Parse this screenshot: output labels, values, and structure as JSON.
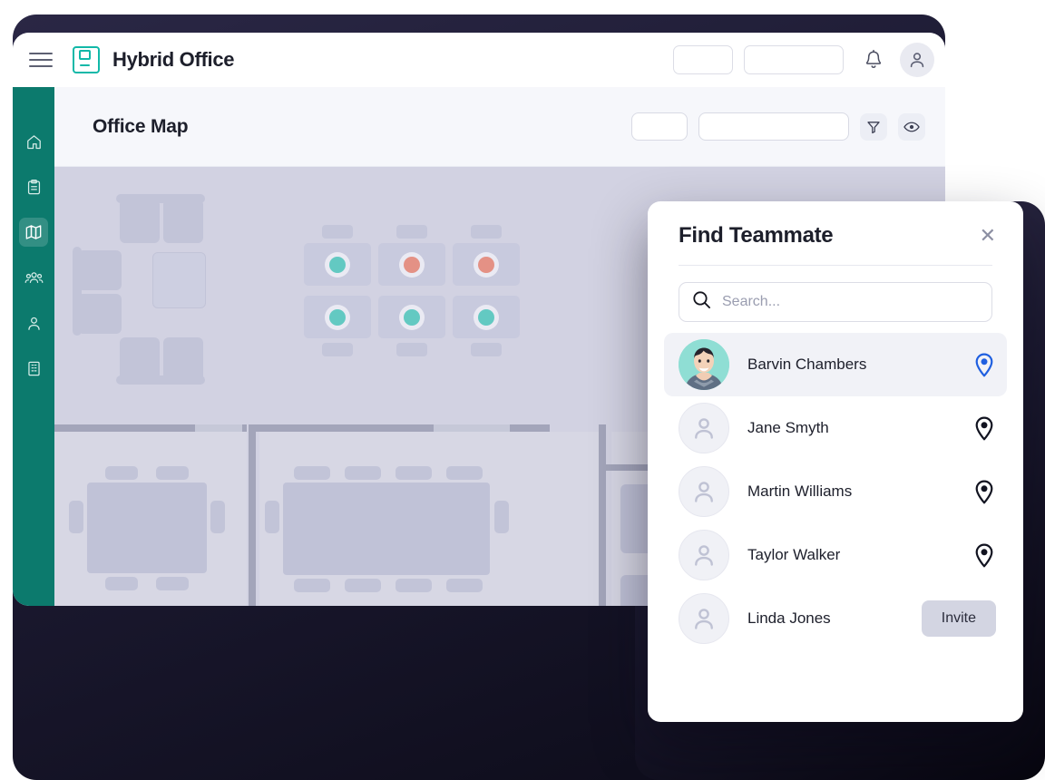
{
  "topbar": {
    "menu_icon": "hamburger-icon",
    "logo_icon": "hybrid-office-logo-icon",
    "brand": "Hybrid Office",
    "placeholder_small": "",
    "placeholder_large": "",
    "bell_icon": "bell-icon",
    "avatar_icon": "user-avatar-icon"
  },
  "sidebar": {
    "items": [
      {
        "name": "home",
        "icon": "home-icon",
        "active": false
      },
      {
        "name": "tasks",
        "icon": "clipboard-icon",
        "active": false
      },
      {
        "name": "map",
        "icon": "map-icon",
        "active": true
      },
      {
        "name": "teams",
        "icon": "users-icon",
        "active": false
      },
      {
        "name": "profile",
        "icon": "person-icon",
        "active": false
      },
      {
        "name": "buildings",
        "icon": "building-icon",
        "active": false
      }
    ]
  },
  "page": {
    "title": "Office Map",
    "field_small": "",
    "field_large": "",
    "filter_icon": "filter-icon",
    "eye_icon": "eye-icon"
  },
  "map": {
    "desks": [
      {
        "row": 1,
        "col": 1,
        "status_color": "#63c9c2"
      },
      {
        "row": 1,
        "col": 2,
        "status_color": "#e49185"
      },
      {
        "row": 1,
        "col": 3,
        "status_color": "#e49185"
      },
      {
        "row": 2,
        "col": 1,
        "status_color": "#63c9c2"
      },
      {
        "row": 2,
        "col": 2,
        "status_color": "#63c9c2"
      },
      {
        "row": 2,
        "col": 3,
        "status_color": "#63c9c2"
      }
    ]
  },
  "panel": {
    "title": "Find Teammate",
    "close_icon": "close-icon",
    "search_icon": "search-icon",
    "search_value": "",
    "search_placeholder": "Search...",
    "people": [
      {
        "name": "Barvin Chambers",
        "selected": true,
        "avatar": "photo-avatar",
        "action": "pin",
        "pin_color": "#1f5fe0"
      },
      {
        "name": "Jane Smyth",
        "selected": false,
        "avatar": "person-icon",
        "action": "pin",
        "pin_color": "#111320"
      },
      {
        "name": "Martin Williams",
        "selected": false,
        "avatar": "person-icon",
        "action": "pin",
        "pin_color": "#111320"
      },
      {
        "name": "Taylor Walker",
        "selected": false,
        "avatar": "person-icon",
        "action": "pin",
        "pin_color": "#111320"
      },
      {
        "name": "Linda Jones",
        "selected": false,
        "avatar": "person-icon",
        "action": "invite",
        "invite_label": "Invite"
      }
    ]
  },
  "colors": {
    "brand_teal": "#11b8a8",
    "sidebar_green": "#0c7a6d",
    "backdrop_navy": "#1b1930",
    "map_bg": "#d2d2e2",
    "accent_blue": "#1f5fe0",
    "seat_free": "#63c9c2",
    "seat_busy": "#e49185"
  }
}
